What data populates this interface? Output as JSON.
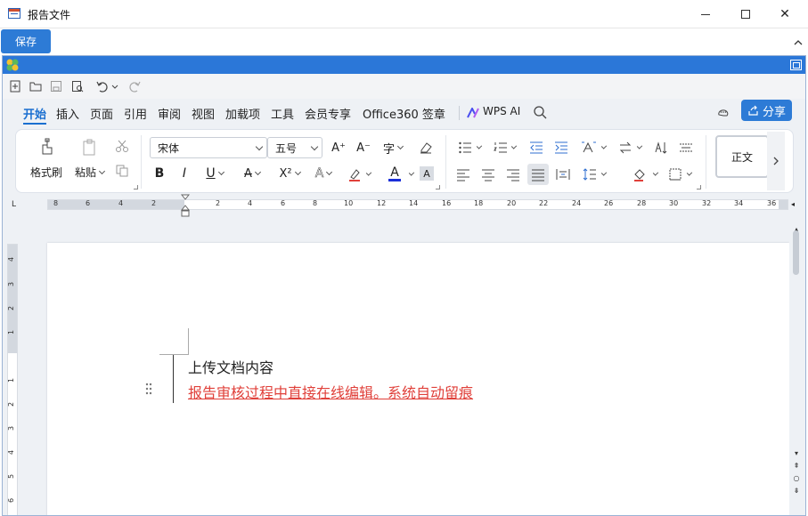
{
  "window": {
    "title": "报告文件",
    "minimize_icon": "minimize-icon",
    "maximize_icon": "maximize-icon",
    "close_label": "✕"
  },
  "toolbar": {
    "save_label": "保存"
  },
  "tabs": [
    {
      "label": "开始",
      "active": true
    },
    {
      "label": "插入"
    },
    {
      "label": "页面"
    },
    {
      "label": "引用"
    },
    {
      "label": "审阅"
    },
    {
      "label": "视图"
    },
    {
      "label": "加载项"
    },
    {
      "label": "工具"
    },
    {
      "label": "会员专享"
    },
    {
      "label": "Office360 签章"
    },
    {
      "label": "WPS AI"
    }
  ],
  "share_label": "分享",
  "ribbon": {
    "format_painter": "格式刷",
    "paste": "粘贴",
    "font_name": "宋体",
    "font_size": "五号",
    "style_normal": "正文",
    "bold": "B",
    "italic": "I",
    "underline": "U",
    "strike": "A",
    "superscript": "X²",
    "font_color_a": "A",
    "highlight_a": "A",
    "grow_font": "A⁺",
    "shrink_font": "A⁻",
    "phonetic": "字"
  },
  "ruler": {
    "left_labels": [
      "8",
      "6",
      "4",
      "2"
    ],
    "right_labels": [
      "2",
      "4",
      "6",
      "8",
      "10",
      "12",
      "14",
      "16",
      "18",
      "20",
      "22",
      "24",
      "26",
      "28",
      "30",
      "32",
      "34",
      "36"
    ],
    "vertical_labels": [
      "4",
      "3",
      "2",
      "1",
      "1",
      "2",
      "3",
      "4",
      "5",
      "6"
    ],
    "corner": "L"
  },
  "document": {
    "line1": "上传文档内容",
    "line2": "报告审核过程中直接在线编辑。系统自动留痕"
  },
  "colors": {
    "accent": "#2d7bd6",
    "tracked_change": "#e0403a",
    "title_blue": "#2b77d8"
  }
}
